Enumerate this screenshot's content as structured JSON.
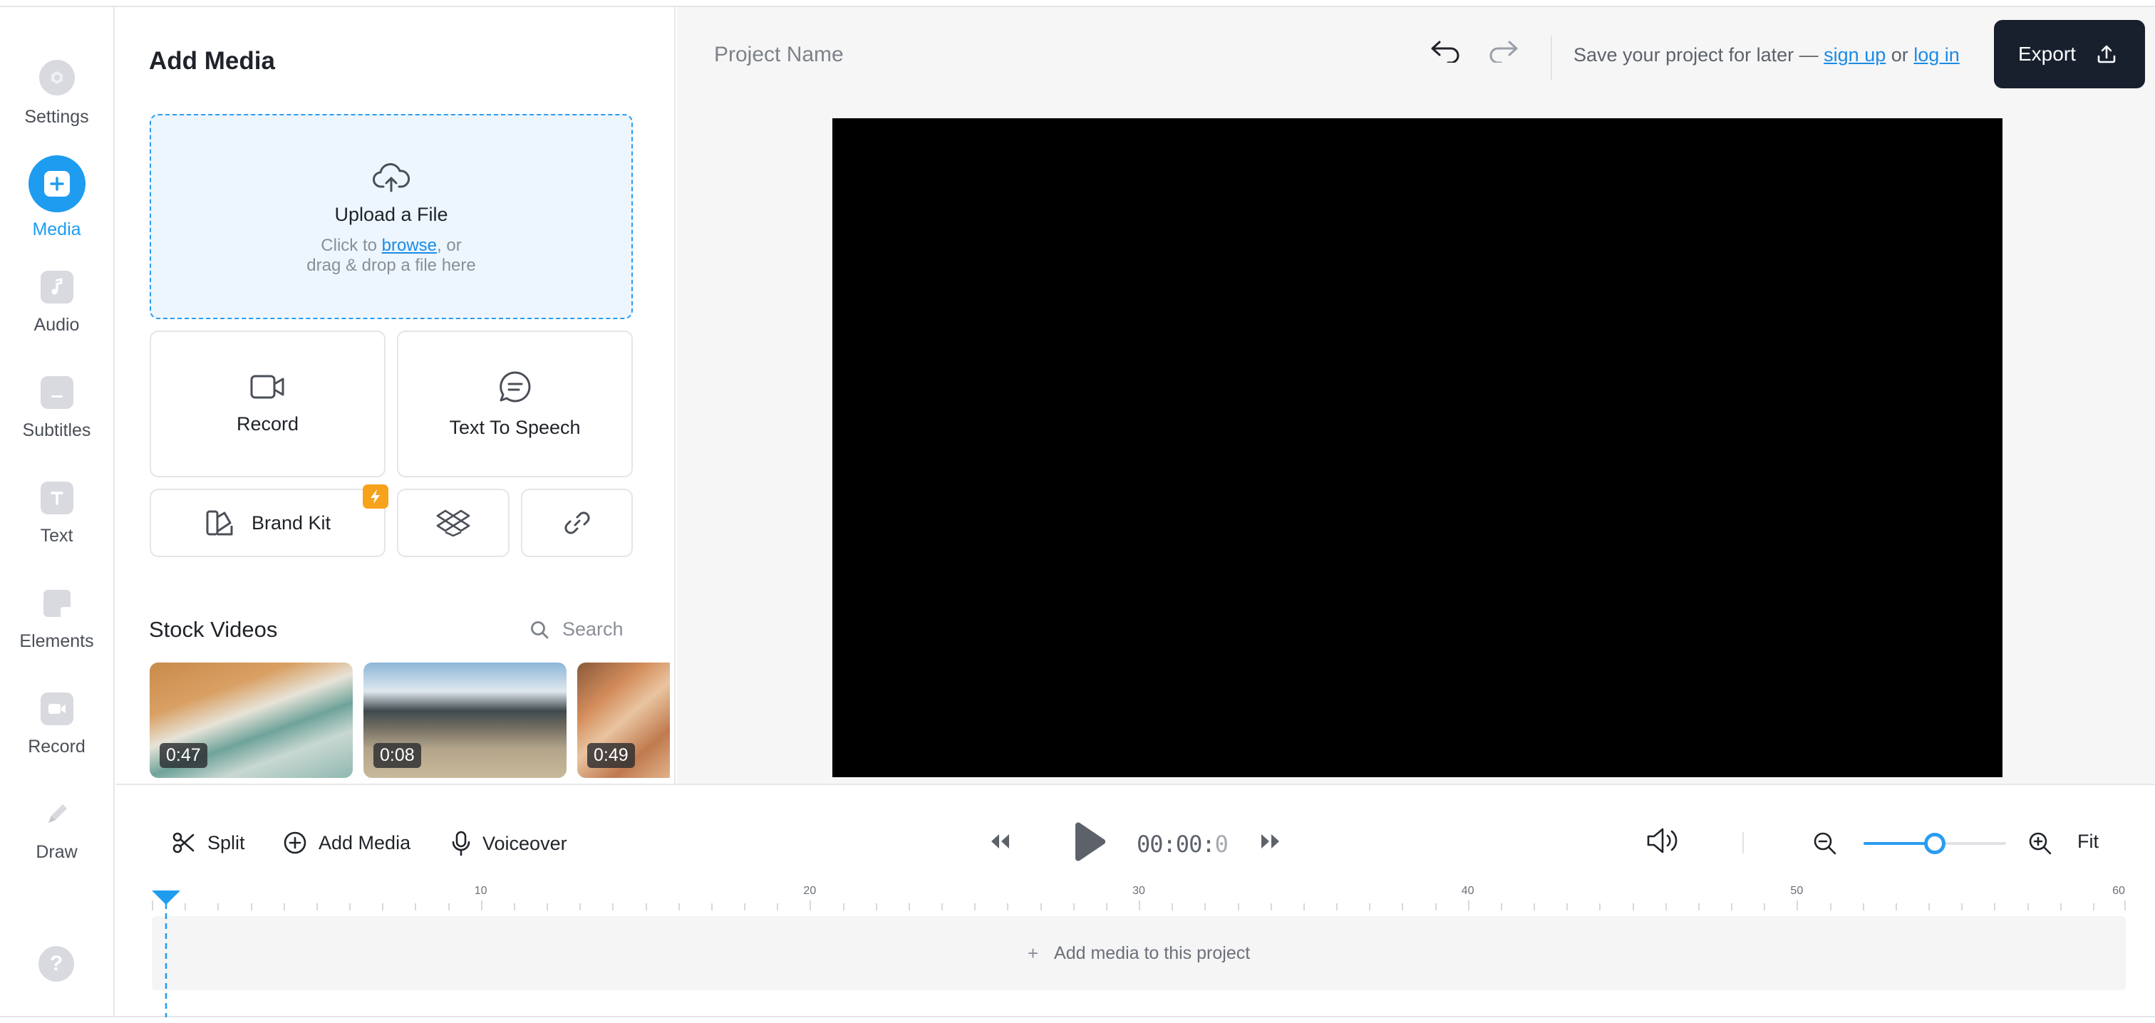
{
  "sidebar": {
    "items": [
      {
        "label": "Settings",
        "icon": "gear-icon"
      },
      {
        "label": "Media",
        "icon": "plus-icon",
        "active": true
      },
      {
        "label": "Audio",
        "icon": "music-note-icon"
      },
      {
        "label": "Subtitles",
        "icon": "subtitles-icon"
      },
      {
        "label": "Text",
        "icon": "text-icon"
      },
      {
        "label": "Elements",
        "icon": "sticker-icon"
      },
      {
        "label": "Record",
        "icon": "camera-icon"
      },
      {
        "label": "Draw",
        "icon": "pencil-icon"
      }
    ],
    "help_icon": "question-icon"
  },
  "media_panel": {
    "title": "Add Media",
    "upload": {
      "title": "Upload a File",
      "line1_prefix": "Click to ",
      "line1_link": "browse",
      "line1_suffix": ", or",
      "line2": "drag & drop a file here"
    },
    "record_label": "Record",
    "tts_label": "Text To Speech",
    "brand_kit_label": "Brand Kit",
    "stock": {
      "title": "Stock Videos",
      "search_label": "Search",
      "videos": [
        {
          "duration": "0:47",
          "theme": "beach-waves"
        },
        {
          "duration": "0:08",
          "theme": "mountain-valley"
        },
        {
          "duration": "0:49",
          "theme": "desert-rock"
        }
      ]
    }
  },
  "topbar": {
    "project_name": "Project Name",
    "save_prefix": "Save your project for later — ",
    "sign_up": "sign up",
    "or": " or ",
    "log_in": "log in",
    "export_label": "Export"
  },
  "timeline": {
    "split_label": "Split",
    "add_media_label": "Add Media",
    "voiceover_label": "Voiceover",
    "timecode_main": "00:00:",
    "timecode_dim": "0",
    "fit_label": "Fit",
    "zoom_fraction": 0.5,
    "ruler": {
      "max": 60,
      "labels": [
        "10",
        "20",
        "30",
        "40",
        "50",
        "60"
      ]
    },
    "empty_track_label": "Add media to this project"
  },
  "colors": {
    "accent": "#1e9cf0",
    "export_bg": "#18202e",
    "badge": "#f7a21b"
  }
}
